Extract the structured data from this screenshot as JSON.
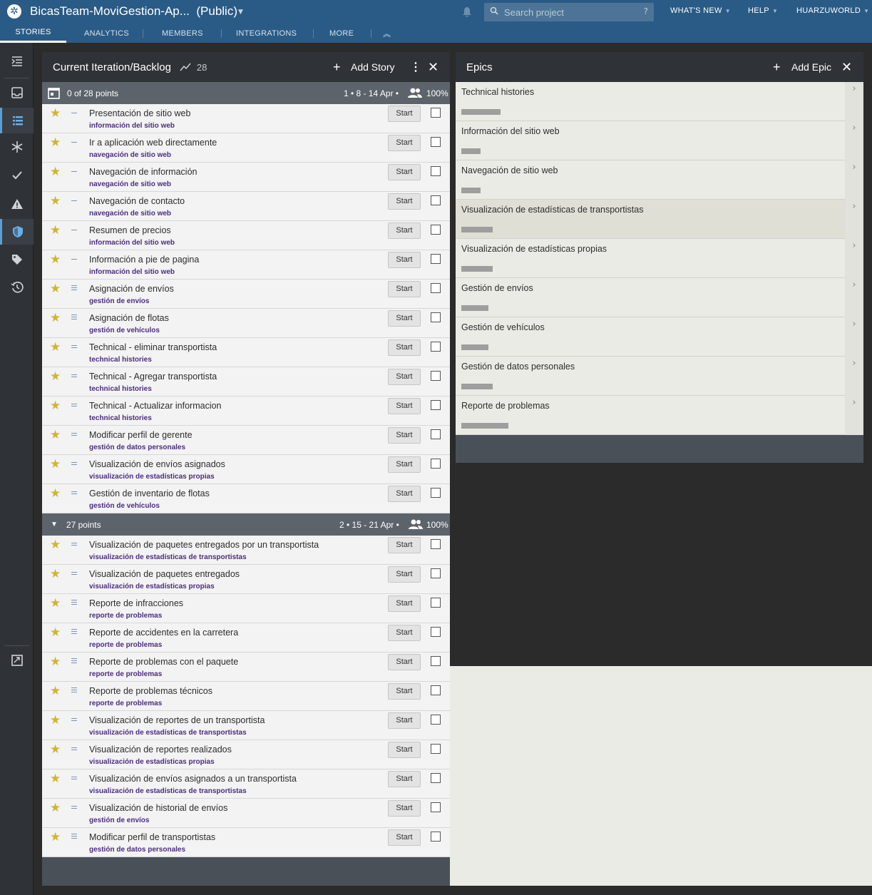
{
  "header": {
    "project_title": "BicasTeam-MoviGestion-Ap...",
    "visibility": "(Public)",
    "search_placeholder": "Search project",
    "search_help": "?",
    "whats_new": "WHAT'S NEW",
    "help": "HELP",
    "user": "HUARZUWORLD"
  },
  "tabs": [
    {
      "label": "STORIES",
      "active": true
    },
    {
      "label": "ANALYTICS"
    },
    {
      "label": "MEMBERS"
    },
    {
      "label": "INTEGRATIONS"
    },
    {
      "label": "MORE"
    }
  ],
  "sidebar": {
    "icons": [
      "collapse-icon",
      "inbox-icon",
      "list-icon",
      "snowflake-icon",
      "check-icon",
      "warning-icon",
      "shield-icon",
      "tag-icon",
      "history-icon",
      "expand-icon"
    ],
    "active": "shield-icon"
  },
  "stories_panel": {
    "title": "Current Iteration/Backlog",
    "velocity": "28",
    "add_label": "Add Story",
    "iterations": [
      {
        "points": "0 of 28 points",
        "dates": "1 • 8 - 14 Apr •",
        "team": "100%",
        "stories": [
          {
            "title": "Presentación de sitio web",
            "label": "información del sitio web",
            "estimate": 1
          },
          {
            "title": "Ir a aplicación web directamente",
            "label": "navegación de sitio web",
            "estimate": 1
          },
          {
            "title": "Navegación de información",
            "label": "navegación de sitio web",
            "estimate": 1
          },
          {
            "title": "Navegación de contacto",
            "label": "navegación de sitio web",
            "estimate": 1
          },
          {
            "title": "Resumen de precios",
            "label": "información del sitio web",
            "estimate": 1
          },
          {
            "title": "Información a pie de pagina",
            "label": "información del sitio web",
            "estimate": 1
          },
          {
            "title": "Asignación de envíos",
            "label": "gestión de envíos",
            "estimate": 3
          },
          {
            "title": "Asignación de flotas",
            "label": "gestión de vehículos",
            "estimate": 3
          },
          {
            "title": "Technical - eliminar transportista",
            "label": "technical histories",
            "estimate": 2
          },
          {
            "title": "Technical - Agregar transportista",
            "label": "technical histories",
            "estimate": 2
          },
          {
            "title": "Technical - Actualizar informacion",
            "label": "technical histories",
            "estimate": 2
          },
          {
            "title": "Modificar perfil de gerente",
            "label": "gestión de datos personales",
            "estimate": 2
          },
          {
            "title": "Visualización de envíos asignados",
            "label": "visualización de estadísticas propias",
            "estimate": 2
          },
          {
            "title": "Gestión de inventario de flotas",
            "label": "gestión de vehículos",
            "estimate": 2
          }
        ]
      },
      {
        "points": "27 points",
        "dates": "2 • 15 - 21 Apr •",
        "team": "100%",
        "stories": [
          {
            "title": "Visualización de paquetes entregados por un transportista",
            "label": "visualización de estadísticas de transportistas",
            "estimate": 2
          },
          {
            "title": "Visualización de paquetes entregados",
            "label": "visualización de estadísticas propias",
            "estimate": 2
          },
          {
            "title": "Reporte de infracciones",
            "label": "reporte de problemas",
            "estimate": 3
          },
          {
            "title": "Reporte de accidentes en la carretera",
            "label": "reporte de problemas",
            "estimate": 3
          },
          {
            "title": "Reporte de problemas con el paquete",
            "label": "reporte de problemas",
            "estimate": 3
          },
          {
            "title": "Reporte de problemas técnicos",
            "label": "reporte de problemas",
            "estimate": 3
          },
          {
            "title": "Visualización de reportes de un transportista",
            "label": "visualización de estadísticas de transportistas",
            "estimate": 2
          },
          {
            "title": "Visualización de reportes realizados",
            "label": "visualización de estadísticas propias",
            "estimate": 2
          },
          {
            "title": "Visualización de envíos asignados a un transportista",
            "label": "visualización de estadísticas de transportistas",
            "estimate": 2
          },
          {
            "title": "Visualización de historial de envíos",
            "label": "gestión de envíos",
            "estimate": 2
          },
          {
            "title": "Modificar perfil de transportistas",
            "label": "gestión de datos personales",
            "estimate": 3
          }
        ]
      }
    ],
    "start_label": "Start"
  },
  "epics_panel": {
    "title": "Epics",
    "add_label": "Add Epic",
    "epics": [
      {
        "name": "Technical histories",
        "progress": 0.1
      },
      {
        "name": "Información del sitio web",
        "progress": 0.05
      },
      {
        "name": "Navegación de sitio web",
        "progress": 0.05
      },
      {
        "name": "Visualización de estadísticas de transportistas",
        "progress": 0.08,
        "highlighted": true
      },
      {
        "name": "Visualización de estadísticas propias",
        "progress": 0.08
      },
      {
        "name": "Gestión de envíos",
        "progress": 0.07
      },
      {
        "name": "Gestión de vehículos",
        "progress": 0.07
      },
      {
        "name": "Gestión de datos personales",
        "progress": 0.08
      },
      {
        "name": "Reporte de problemas",
        "progress": 0.12
      }
    ]
  }
}
